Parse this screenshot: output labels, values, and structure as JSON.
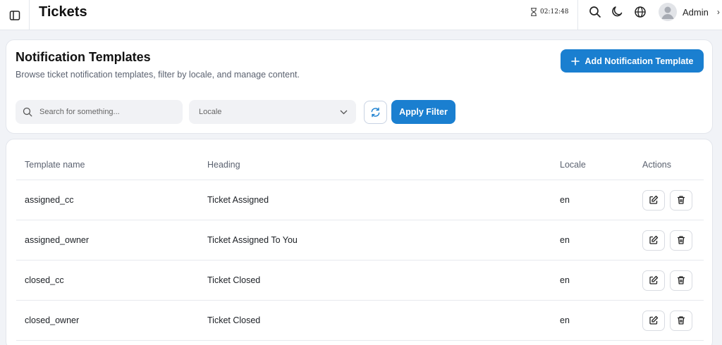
{
  "header": {
    "title": "Tickets",
    "timer": "02:12:48",
    "user_name": "Admin",
    "icons": [
      "sidebar-toggle-icon",
      "hourglass-icon",
      "search-icon",
      "moon-icon",
      "globe-icon",
      "user-icon",
      "chevron-right-icon"
    ]
  },
  "filters_card": {
    "title": "Notification Templates",
    "subtitle": "Browse ticket notification templates, filter by locale, and manage content.",
    "add_button": "Add Notification Template",
    "search_placeholder": "Search for something...",
    "locale_placeholder": "Locale",
    "apply_button": "Apply Filter"
  },
  "table": {
    "columns": [
      "Template name",
      "Heading",
      "Locale",
      "Actions"
    ],
    "rows": [
      {
        "name": "assigned_cc",
        "heading": "Ticket Assigned",
        "locale": "en"
      },
      {
        "name": "assigned_owner",
        "heading": "Ticket Assigned To You",
        "locale": "en"
      },
      {
        "name": "closed_cc",
        "heading": "Ticket Closed",
        "locale": "en"
      },
      {
        "name": "closed_owner",
        "heading": "Ticket Closed",
        "locale": "en"
      }
    ]
  },
  "colors": {
    "accent": "#1a7fd0",
    "background": "#f1f3f7"
  }
}
